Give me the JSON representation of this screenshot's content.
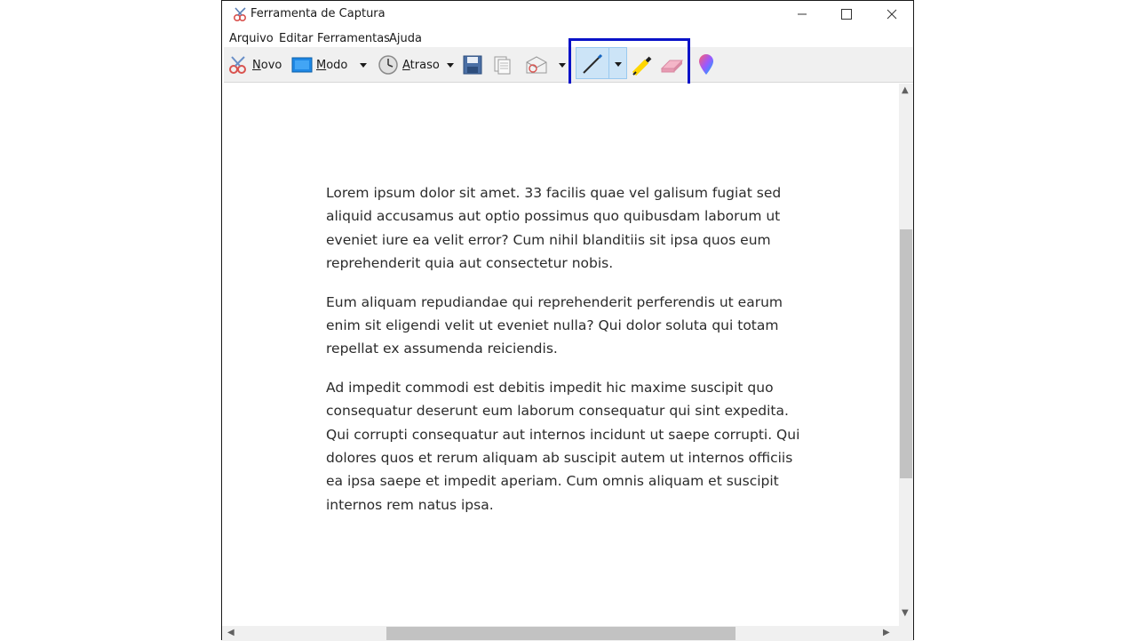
{
  "window": {
    "title": "Ferramenta de Captura"
  },
  "menu": {
    "items": [
      "Arquivo",
      "Editar",
      "Ferramentas",
      "Ajuda"
    ]
  },
  "toolbar": {
    "new_label": "Novo",
    "mode_label": "Modo",
    "delay_label": "Atraso",
    "icons": [
      "scissors-icon",
      "mode-icon",
      "clock-icon",
      "save-icon",
      "copy-icon",
      "send-icon",
      "pen-icon",
      "highlighter-icon",
      "eraser-icon",
      "paint3d-icon"
    ]
  },
  "document": {
    "paragraphs": [
      "Lorem ipsum dolor sit amet. 33 facilis quae vel galisum fugiat sed aliquid accusamus aut optio possimus quo quibusdam laborum ut eveniet iure ea velit error? Cum nihil blanditiis sit ipsa quos eum reprehenderit quia aut consectetur nobis.",
      "Eum aliquam repudiandae qui reprehenderit perferendis ut earum enim sit eligendi velit ut eveniet nulla? Qui dolor soluta qui totam repellat ex assumenda reiciendis.",
      "Ad impedit commodi est debitis impedit hic maxime suscipit quo consequatur deserunt eum laborum consequatur qui sint expedita. Qui corrupti consequatur aut internos incidunt ut saepe corrupti. Qui dolores quos et rerum aliquam ab suscipit autem ut internos officiis ea ipsa saepe et impedit aperiam. Cum omnis aliquam et suscipit internos rem natus ipsa."
    ]
  },
  "colors": {
    "highlight_box": "#0a12c8",
    "pen_selected": "#cce4f7"
  }
}
